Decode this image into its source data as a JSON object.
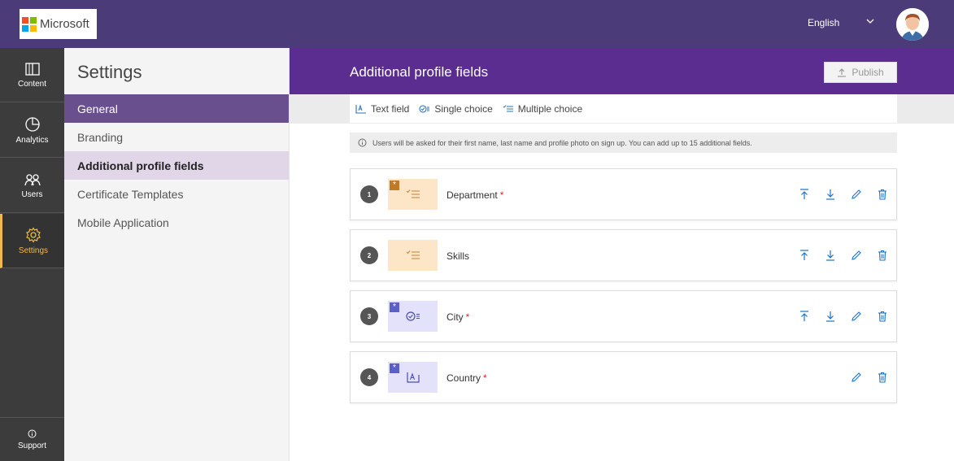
{
  "brand": {
    "logo_text": "Microsoft"
  },
  "header": {
    "language": "English"
  },
  "nav": {
    "items": [
      {
        "label": "Content",
        "icon": "book-icon"
      },
      {
        "label": "Analytics",
        "icon": "pie-chart-icon"
      },
      {
        "label": "Users",
        "icon": "users-icon"
      },
      {
        "label": "Settings",
        "icon": "gear-icon"
      }
    ],
    "support": "Support"
  },
  "settings": {
    "title": "Settings",
    "items": [
      "General",
      "Branding",
      "Additional profile fields",
      "Certificate Templates",
      "Mobile Application"
    ]
  },
  "main": {
    "title": "Additional profile fields",
    "publish": "Publish",
    "toolbar": [
      "Text field",
      "Single choice",
      "Multiple choice"
    ],
    "info": "Users will be asked for their first name, last name and profile photo on sign up. You can add up to 15 additional fields."
  },
  "fields": [
    {
      "num": "1",
      "label": "Department",
      "required": "*",
      "type": "multiple-choice"
    },
    {
      "num": "2",
      "label": "Skills",
      "required": "",
      "type": "multiple-choice"
    },
    {
      "num": "3",
      "label": "City",
      "required": "*",
      "type": "single-choice"
    },
    {
      "num": "4",
      "label": "Country",
      "required": "*",
      "type": "text-field"
    }
  ],
  "colors": {
    "topbar": "#4b3b79",
    "header": "#5c2d91",
    "accent": "#f2b84b",
    "action_blue": "#1a73c6",
    "required": "#d9262e"
  }
}
